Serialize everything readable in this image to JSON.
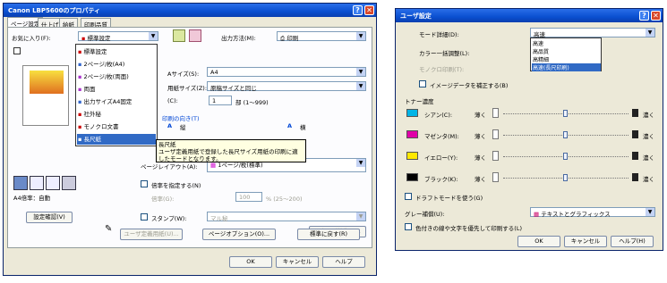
{
  "left": {
    "title": "Canon LBP5600のプロパティ",
    "tabs": [
      "ページ設定",
      "仕上げ",
      "給紙",
      "印刷品質"
    ],
    "favorite_label": "お気に入り(F):",
    "favorite_value": "標準設定",
    "favorites": [
      "標準設定",
      "2ページ/枚(A4)",
      "2ページ/枚(両面)",
      "両面",
      "出力サイズA4固定",
      "社外秘",
      "モノクロ文書",
      "長尺紙"
    ],
    "output_method_label": "出力方法(M):",
    "output_method_value": "印刷",
    "paper_size_label": "Aサイズ(S):",
    "paper_size_value": "A4",
    "output_size_label": "用紙サイズ(Z):",
    "output_size_value": "原稿サイズと同じ",
    "copies_label": "(C):",
    "copies_value": "1",
    "copies_range": "部 (1～999)",
    "orientation_label": "印刷の向き(T)",
    "portrait": "縦",
    "landscape": "横",
    "layout_label": "ページレイアウト(A):",
    "layout_value": "1ページ/枚(標準)",
    "scale_check": "倍率を指定する(N)",
    "scale_label": "倍率(G):",
    "scale_value": "100",
    "scale_range": "% (25～200)",
    "stamp_check": "スタンプ(W):",
    "stamp_value": "マル秘",
    "stamp_edit": "スタンプ編集(I)...",
    "preview_caption": "A4倍率：自動",
    "settings_button": "設定確認(V)",
    "user_paper_button": "ユーザ定義用紙(U)...",
    "page_options_button": "ページオプション(O)...",
    "restore_button": "標準に戻す(R)",
    "ok": "OK",
    "cancel": "キャンセル",
    "help": "ヘルプ",
    "tooltip_line1": "長尺紙",
    "tooltip_line2": "ユーザ定義用紙で登録した長尺サイズ用紙の印刷に適したモードとなります。"
  },
  "right": {
    "title": "ユーザ設定",
    "mode_label": "モード詳細(D):",
    "mode_value": "高速",
    "mode_options": [
      "高速",
      "高品質",
      "高精細",
      "高速(長尺印刷)"
    ],
    "color_label": "カラー一括調整(L):",
    "mono_label": "モノクロ印刷(T):",
    "image_check": "イメージデータを補正する(B)",
    "toner_label": "トナー濃度",
    "light": "薄く",
    "dark": "濃く",
    "colors": [
      {
        "name": "シアン(C):",
        "color": "#00b4e6",
        "level": 0.5
      },
      {
        "name": "マゼンタ(M):",
        "color": "#e000a8",
        "level": 0.5
      },
      {
        "name": "イエロー(Y):",
        "color": "#ffe800",
        "level": 0.5
      },
      {
        "name": "ブラック(K):",
        "color": "#000000",
        "level": 0.5
      }
    ],
    "draft_check": "ドラフトモードを使う(G)",
    "gray_label": "グレー補償(U):",
    "gray_value": "テキストとグラフィックス",
    "priority_check": "色付きの線や文字を優先して印刷する(L)",
    "ok": "OK",
    "cancel": "キャンセル",
    "help": "ヘルプ(H)"
  }
}
